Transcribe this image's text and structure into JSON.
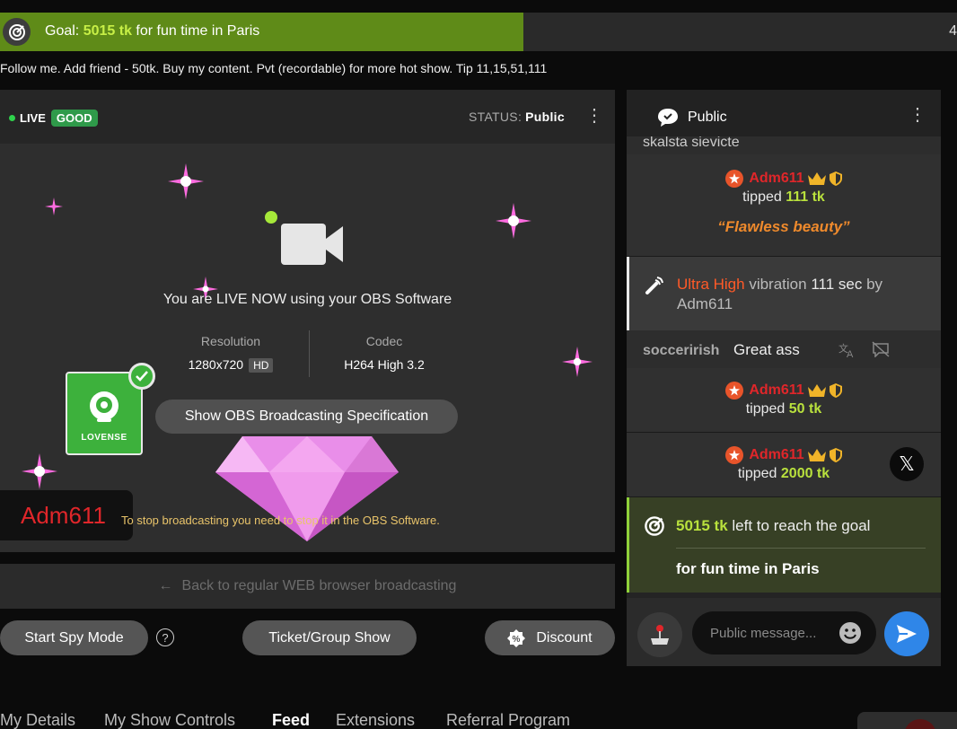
{
  "goal": {
    "prefix": "Goal:",
    "amount": "5015 tk",
    "suffix": "for fun time in Paris",
    "end_char": "4",
    "progress": 0.547
  },
  "topic": "Follow me. Add friend - 50tk. Buy my content. Pvt (recordable) for more hot show. Tip 11,15,51,111",
  "broadcast": {
    "live_label": "LIVE",
    "quality_badge": "GOOD",
    "status_label": "STATUS:",
    "status_value": "Public",
    "live_now_text": "You are LIVE NOW using your OBS Software",
    "resolution_label": "Resolution",
    "resolution_value": "1280x720",
    "hd_badge": "HD",
    "codec_label": "Codec",
    "codec_value": "H264 High 3.2",
    "spec_button": "Show OBS Broadcasting Specification",
    "lovense_label": "LOVENSE",
    "username": "Adm611",
    "stop_note": "To stop broadcasting you need to stop it in the OBS Software.",
    "back_button": "Back to regular WEB browser broadcasting"
  },
  "actions": {
    "spy_mode": "Start Spy Mode",
    "help": "?",
    "ticket_show": "Ticket/Group Show",
    "discount": "Discount"
  },
  "tabs": [
    "My Details",
    "My Show Controls",
    "Feed",
    "Extensions",
    "Referral Program"
  ],
  "active_tab": "Feed",
  "chat": {
    "tab_label": "Public",
    "cut_off_text": "skalsta sievicte",
    "messages": [
      {
        "type": "tip",
        "user": "Adm611",
        "verb": "tipped",
        "amount": "111 tk",
        "note": "“Flawless beauty”"
      },
      {
        "type": "vibration",
        "level": "Ultra High",
        "text": "vibration",
        "duration": "111 sec",
        "by": "by",
        "user": "Adm611"
      },
      {
        "type": "chat",
        "user": "soccerirish",
        "text": "Great ass"
      },
      {
        "type": "tip",
        "user": "Adm611",
        "verb": "tipped",
        "amount": "50 tk"
      },
      {
        "type": "tip",
        "user": "Adm611",
        "verb": "tipped",
        "amount": "2000 tk"
      }
    ],
    "goal_card": {
      "amount": "5015 tk",
      "text": "left to reach the goal",
      "title": "for fun time in Paris"
    },
    "input_placeholder": "Public message..."
  },
  "colors": {
    "goal_fill": "#5f8b18",
    "accent_green": "#b9e13d",
    "username_red": "#e0262a",
    "vibration_orange": "#ff5a28",
    "send_blue": "#2f86e8",
    "lovense_green": "#3db13c"
  },
  "icons": [
    "goal-target-icon",
    "video-camera-icon",
    "kebab-menu-icon",
    "lovense-logo-icon",
    "check-icon",
    "arrow-left-icon",
    "help-icon",
    "discount-icon",
    "chat-bubble-icon",
    "star-badge-icon",
    "crown-icon",
    "shield-icon",
    "vibration-icon",
    "translate-icon",
    "hide-message-icon",
    "x-logo-icon",
    "joystick-icon",
    "emoji-icon",
    "send-icon",
    "diamond-icon",
    "sparkle-icon"
  ]
}
